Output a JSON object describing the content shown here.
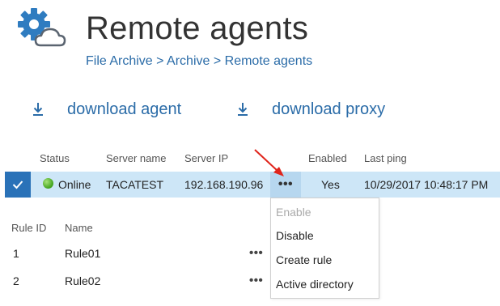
{
  "header": {
    "title": "Remote agents",
    "icon": "gear-cloud-icon",
    "breadcrumb": "File Archive > Archive > Remote agents"
  },
  "actions": {
    "download_agent": {
      "label": "download agent",
      "icon": "download-icon"
    },
    "download_proxy": {
      "label": "download proxy",
      "icon": "download-icon"
    }
  },
  "agents_grid": {
    "columns": [
      "Status",
      "Server name",
      "Server IP",
      "Enabled",
      "Last ping"
    ],
    "rows": [
      {
        "selected": true,
        "status": "Online",
        "status_color": "#3fa21b",
        "server_name": "TACATEST",
        "server_ip": "192.168.190.96",
        "more": "•••",
        "enabled": "Yes",
        "last_ping": "10/29/2017 10:48:17 PM"
      }
    ]
  },
  "context_menu": {
    "items": [
      {
        "label": "Enable",
        "disabled": true
      },
      {
        "label": "Disable",
        "disabled": false
      },
      {
        "label": "Create rule",
        "disabled": false
      },
      {
        "label": "Active directory",
        "disabled": false
      }
    ]
  },
  "rules_grid": {
    "columns": [
      "Rule ID",
      "Name"
    ],
    "rows": [
      {
        "id": "1",
        "name": "Rule01",
        "more": "•••"
      },
      {
        "id": "2",
        "name": "Rule02",
        "more": "•••"
      }
    ]
  },
  "colors": {
    "accent": "#2b6ca8",
    "selected_row": "#cde6f7",
    "checkbox": "#2a72b8",
    "annotation_arrow": "#e0241b"
  }
}
